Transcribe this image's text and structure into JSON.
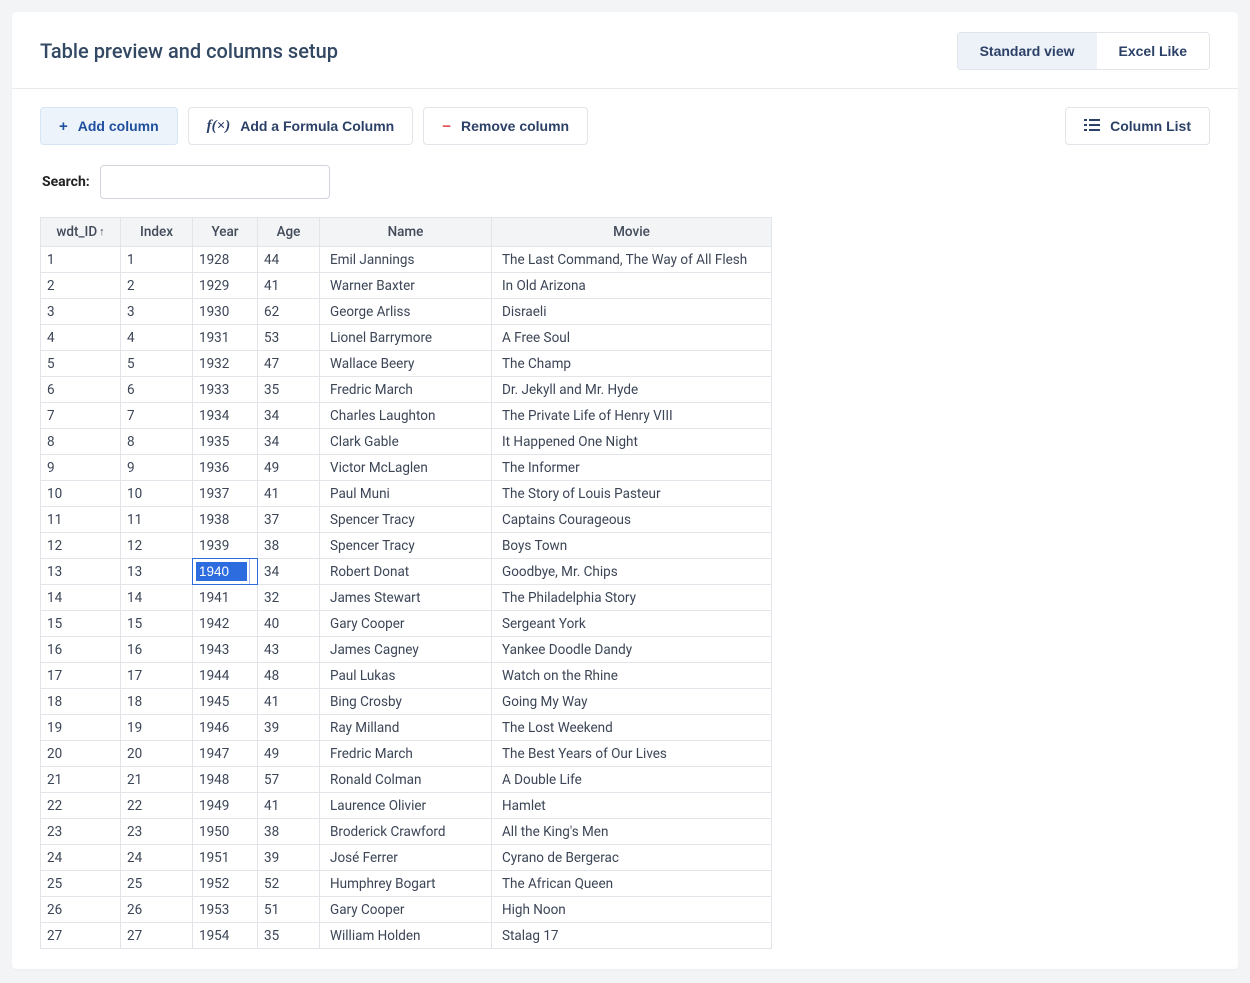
{
  "header": {
    "title": "Table preview and columns setup",
    "view_standard": "Standard view",
    "view_excel": "Excel Like"
  },
  "toolbar": {
    "add_column": "Add column",
    "add_formula": "Add a Formula Column",
    "remove_column": "Remove column",
    "column_list": "Column List"
  },
  "search": {
    "label": "Search:",
    "value": ""
  },
  "table": {
    "columns": {
      "wdt_id": "wdt_ID",
      "index": "Index",
      "year": "Year",
      "age": "Age",
      "name": "Name",
      "movie": "Movie"
    },
    "editing_cell": {
      "row": 12,
      "col": "year",
      "value": "1940"
    },
    "rows": [
      {
        "wdt_id": "1",
        "index": "1",
        "year": "1928",
        "age": "44",
        "name": "Emil Jannings",
        "movie": "The Last Command, The Way of All Flesh"
      },
      {
        "wdt_id": "2",
        "index": "2",
        "year": "1929",
        "age": "41",
        "name": "Warner Baxter",
        "movie": "In Old Arizona"
      },
      {
        "wdt_id": "3",
        "index": "3",
        "year": "1930",
        "age": "62",
        "name": "George Arliss",
        "movie": "Disraeli"
      },
      {
        "wdt_id": "4",
        "index": "4",
        "year": "1931",
        "age": "53",
        "name": "Lionel Barrymore",
        "movie": "A Free Soul"
      },
      {
        "wdt_id": "5",
        "index": "5",
        "year": "1932",
        "age": "47",
        "name": "Wallace Beery",
        "movie": "The Champ"
      },
      {
        "wdt_id": "6",
        "index": "6",
        "year": "1933",
        "age": "35",
        "name": "Fredric March",
        "movie": "Dr. Jekyll and Mr. Hyde"
      },
      {
        "wdt_id": "7",
        "index": "7",
        "year": "1934",
        "age": "34",
        "name": "Charles Laughton",
        "movie": "The Private Life of Henry VIII"
      },
      {
        "wdt_id": "8",
        "index": "8",
        "year": "1935",
        "age": "34",
        "name": "Clark Gable",
        "movie": "It Happened One Night"
      },
      {
        "wdt_id": "9",
        "index": "9",
        "year": "1936",
        "age": "49",
        "name": "Victor McLaglen",
        "movie": "The Informer"
      },
      {
        "wdt_id": "10",
        "index": "10",
        "year": "1937",
        "age": "41",
        "name": "Paul Muni",
        "movie": "The Story of Louis Pasteur"
      },
      {
        "wdt_id": "11",
        "index": "11",
        "year": "1938",
        "age": "37",
        "name": "Spencer Tracy",
        "movie": "Captains Courageous"
      },
      {
        "wdt_id": "12",
        "index": "12",
        "year": "1939",
        "age": "38",
        "name": "Spencer Tracy",
        "movie": "Boys Town"
      },
      {
        "wdt_id": "13",
        "index": "13",
        "year": "1940",
        "age": "34",
        "name": "Robert Donat",
        "movie": "Goodbye, Mr. Chips"
      },
      {
        "wdt_id": "14",
        "index": "14",
        "year": "1941",
        "age": "32",
        "name": "James Stewart",
        "movie": "The Philadelphia Story"
      },
      {
        "wdt_id": "15",
        "index": "15",
        "year": "1942",
        "age": "40",
        "name": "Gary Cooper",
        "movie": "Sergeant York"
      },
      {
        "wdt_id": "16",
        "index": "16",
        "year": "1943",
        "age": "43",
        "name": "James Cagney",
        "movie": "Yankee Doodle Dandy"
      },
      {
        "wdt_id": "17",
        "index": "17",
        "year": "1944",
        "age": "48",
        "name": "Paul Lukas",
        "movie": "Watch on the Rhine"
      },
      {
        "wdt_id": "18",
        "index": "18",
        "year": "1945",
        "age": "41",
        "name": "Bing Crosby",
        "movie": "Going My Way"
      },
      {
        "wdt_id": "19",
        "index": "19",
        "year": "1946",
        "age": "39",
        "name": "Ray Milland",
        "movie": "The Lost Weekend"
      },
      {
        "wdt_id": "20",
        "index": "20",
        "year": "1947",
        "age": "49",
        "name": "Fredric March",
        "movie": "The Best Years of Our Lives"
      },
      {
        "wdt_id": "21",
        "index": "21",
        "year": "1948",
        "age": "57",
        "name": "Ronald Colman",
        "movie": "A Double Life"
      },
      {
        "wdt_id": "22",
        "index": "22",
        "year": "1949",
        "age": "41",
        "name": "Laurence Olivier",
        "movie": "Hamlet"
      },
      {
        "wdt_id": "23",
        "index": "23",
        "year": "1950",
        "age": "38",
        "name": "Broderick Crawford",
        "movie": "All the King's Men"
      },
      {
        "wdt_id": "24",
        "index": "24",
        "year": "1951",
        "age": "39",
        "name": "José Ferrer",
        "movie": "Cyrano de Bergerac"
      },
      {
        "wdt_id": "25",
        "index": "25",
        "year": "1952",
        "age": "52",
        "name": "Humphrey Bogart",
        "movie": "The African Queen"
      },
      {
        "wdt_id": "26",
        "index": "26",
        "year": "1953",
        "age": "51",
        "name": "Gary Cooper",
        "movie": "High Noon"
      },
      {
        "wdt_id": "27",
        "index": "27",
        "year": "1954",
        "age": "35",
        "name": "William Holden",
        "movie": "Stalag 17"
      }
    ]
  }
}
